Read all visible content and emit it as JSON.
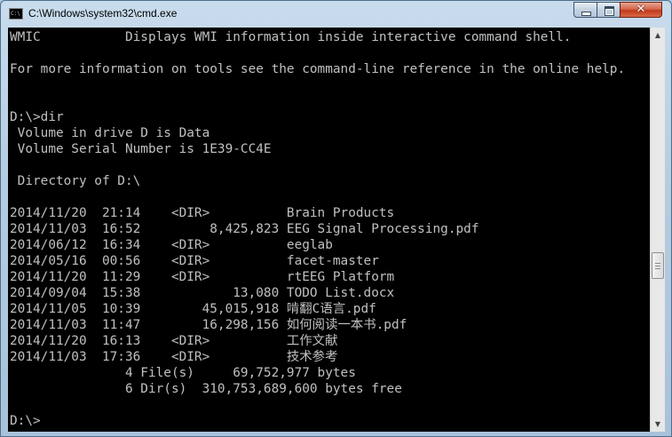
{
  "window": {
    "title": "C:\\Windows\\system32\\cmd.exe",
    "icon_label": "C:\\",
    "buttons": {
      "minimize": "minimize",
      "maximize": "maximize",
      "close": "✕"
    }
  },
  "console": {
    "lines": [
      "WMIC           Displays WMI information inside interactive command shell.",
      "",
      "For more information on tools see the command-line reference in the online help.",
      "",
      "",
      "D:\\>dir",
      " Volume in drive D is Data",
      " Volume Serial Number is 1E39-CC4E",
      "",
      " Directory of D:\\",
      "",
      "2014/11/20  21:14    <DIR>          Brain Products",
      "2014/11/03  16:52         8,425,823 EEG Signal Processing.pdf",
      "2014/06/12  16:34    <DIR>          eeglab",
      "2014/05/16  00:56    <DIR>          facet-master",
      "2014/11/20  11:29    <DIR>          rtEEG Platform",
      "2014/09/04  15:38            13,080 TODO List.docx",
      "2014/11/05  10:39        45,015,918 啃翻C语言.pdf",
      "2014/11/03  11:47        16,298,156 如何阅读一本书.pdf",
      "2014/11/20  16:13    <DIR>          工作文献",
      "2014/11/03  17:36    <DIR>          技术参考",
      "               4 File(s)     69,752,977 bytes",
      "               6 Dir(s)  310,753,689,600 bytes free",
      "",
      "D:\\>"
    ]
  },
  "scrollbar": {
    "up_arrow": "▲",
    "down_arrow": "▼",
    "position_fraction": 0.56
  },
  "colors": {
    "console_bg": "#000000",
    "console_text": "#c0c0c0",
    "frame": "#b5cde1",
    "close_button": "#c2381a"
  }
}
